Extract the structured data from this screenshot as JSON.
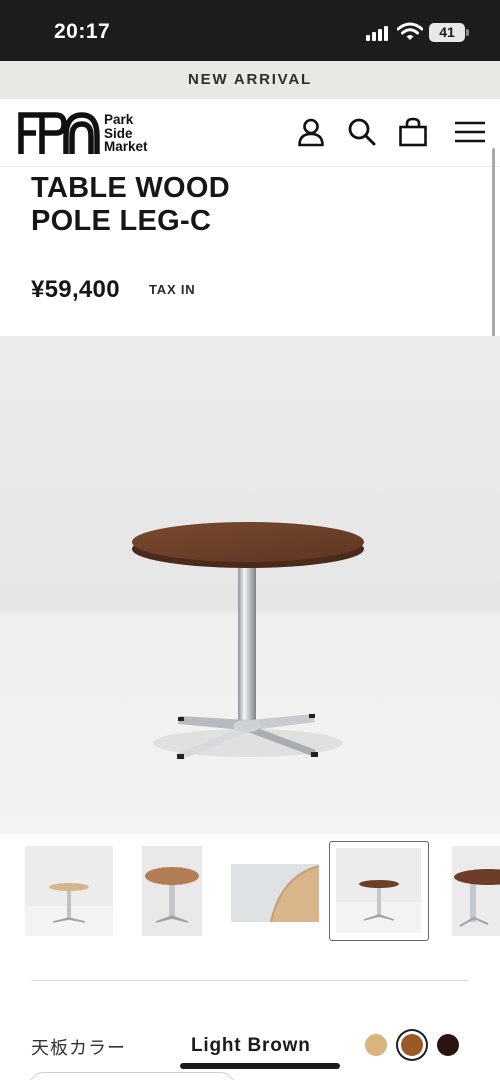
{
  "status_bar": {
    "time": "20:17",
    "battery": "41",
    "icons": [
      "cellular-signal-icon",
      "wifi-icon",
      "battery-icon"
    ]
  },
  "announcement": "NEW ARRIVAL",
  "header": {
    "logo_text": [
      "Park",
      "Side",
      "Market"
    ],
    "icons": [
      "account-icon",
      "search-icon",
      "bag-icon",
      "menu-icon"
    ]
  },
  "product": {
    "title_line1": "TABLE WOOD",
    "title_line2": "POLE LEG-C",
    "price": "¥59,400",
    "tax_label": "TAX IN"
  },
  "gallery": {
    "thumbnail_count": 5,
    "selected_index": 3
  },
  "options": {
    "color_label": "天板カラー",
    "color_value": "Light Brown",
    "swatches": [
      {
        "name": "natural",
        "color": "#d9b47c",
        "selected": false
      },
      {
        "name": "light-brown",
        "color": "#9a5a25",
        "selected": true
      },
      {
        "name": "dark-brown",
        "color": "#2a1410",
        "selected": false
      }
    ]
  },
  "colors": {
    "status_bar_bg": "#1c1c1c",
    "announcement_bg": "#e8e8e5",
    "tabletop": "#6e3f28",
    "chrome": "#c9ccd0"
  }
}
